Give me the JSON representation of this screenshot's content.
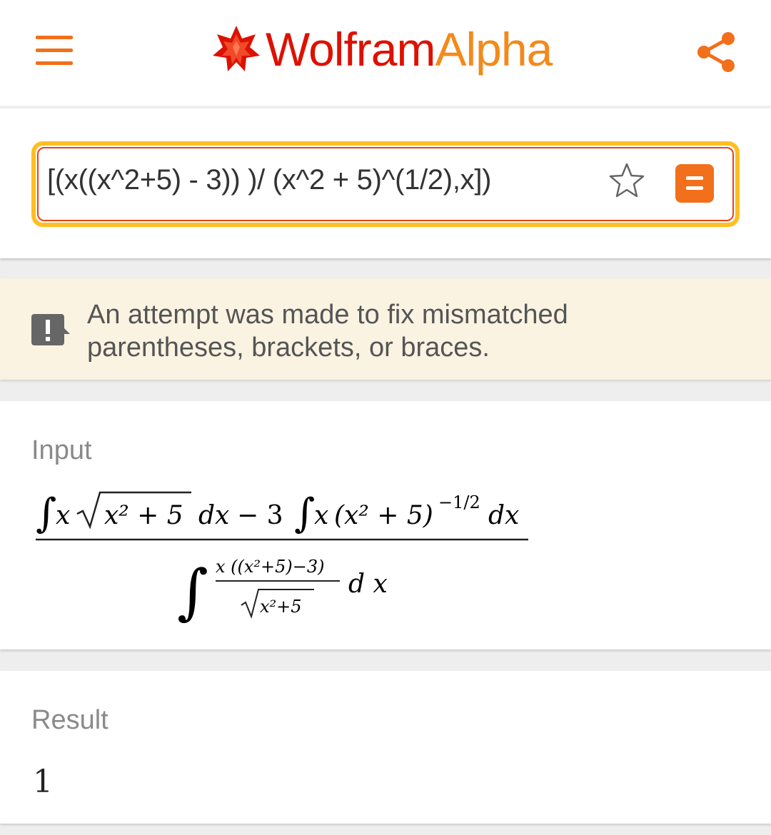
{
  "header": {
    "logo_wolfram": "Wolfram",
    "logo_alpha": "Alpha",
    "menu_icon": "hamburger-menu-icon",
    "share_icon": "share-icon"
  },
  "search": {
    "query": "[(x((x^2+5) - 3)) )/ (x^2 + 5)^(1/2),x])",
    "star_icon": "star-outline-icon",
    "equals_icon": "equals-icon"
  },
  "warning": {
    "icon": "exclamation-badge-icon",
    "text_line1": "An attempt was made to fix mismatched",
    "text_line2": "parentheses, brackets, or braces."
  },
  "input_pod": {
    "title": "Input",
    "numerator": {
      "sqrt_arg": "x² + 5",
      "d": "d",
      "x": "x",
      "minus_three": "− 3",
      "paren_body": "(x² + 5)",
      "exponent": "−1/2"
    },
    "denominator": {
      "inner_num": "x ((x²+5)−3)",
      "inner_den": "x²+5",
      "dx": "d x"
    }
  },
  "result_pod": {
    "title": "Result",
    "value": "1"
  },
  "colors": {
    "accent": "#f26f1b",
    "logo_red": "#dd1100",
    "logo_orange": "#f28a1c",
    "search_border": "#ffbe22",
    "warning_bg": "#faf3e2"
  }
}
